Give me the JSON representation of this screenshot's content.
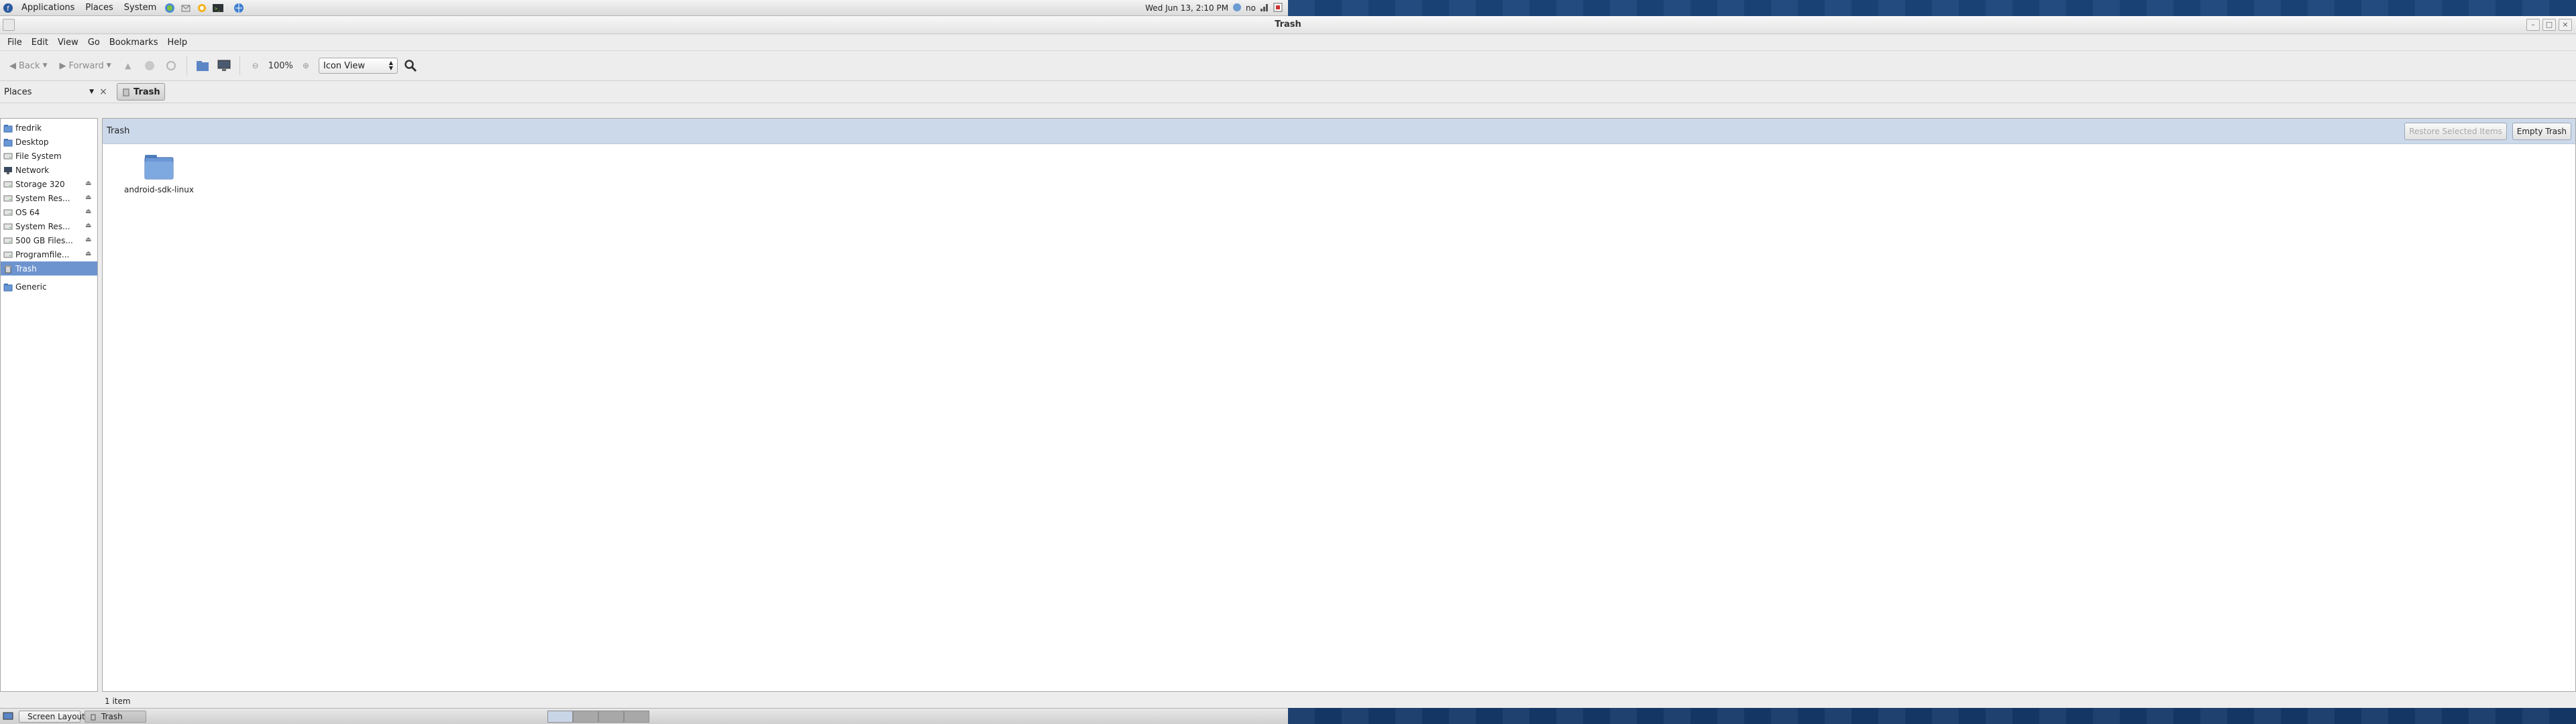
{
  "top_panel": {
    "menus": [
      "Applications",
      "Places",
      "System"
    ],
    "clock": "Wed Jun 13,  2:10 PM",
    "language": "no"
  },
  "window": {
    "title": "Trash",
    "menus": [
      "File",
      "Edit",
      "View",
      "Go",
      "Bookmarks",
      "Help"
    ],
    "toolbar": {
      "back": "Back",
      "forward": "Forward",
      "zoom": "100%",
      "view_mode": "Icon View"
    },
    "location": {
      "sidebar_label": "Places",
      "path_button": "Trash"
    },
    "sidebar": {
      "items": [
        {
          "label": "fredrik",
          "icon": "home-folder-icon"
        },
        {
          "label": "Desktop",
          "icon": "desktop-folder-icon"
        },
        {
          "label": "File System",
          "icon": "drive-icon"
        },
        {
          "label": "Network",
          "icon": "network-icon"
        },
        {
          "label": "Storage 320",
          "icon": "drive-icon",
          "eject": true
        },
        {
          "label": "System Res...",
          "icon": "drive-icon",
          "eject": true
        },
        {
          "label": "OS 64",
          "icon": "drive-icon",
          "eject": true
        },
        {
          "label": "System Res...",
          "icon": "drive-icon",
          "eject": true
        },
        {
          "label": "500 GB Files...",
          "icon": "drive-icon",
          "eject": true
        },
        {
          "label": "Programfile...",
          "icon": "drive-icon",
          "eject": true
        },
        {
          "label": "Trash",
          "icon": "trash-icon",
          "selected": true
        }
      ],
      "bookmarks": [
        {
          "label": "Generic",
          "icon": "folder-icon"
        }
      ]
    },
    "trash_bar": {
      "title": "Trash",
      "restore_button": "Restore Selected Items",
      "empty_button": "Empty Trash"
    },
    "files": [
      {
        "name": "android-sdk-linux"
      }
    ],
    "status": "1 item"
  },
  "taskbar": {
    "tasks": [
      "Screen Layout Editor",
      "Trash"
    ]
  },
  "colors": {
    "selection": "#6d94cf",
    "trash_bar": "#ccd9ea",
    "desktop": "#183f74"
  }
}
